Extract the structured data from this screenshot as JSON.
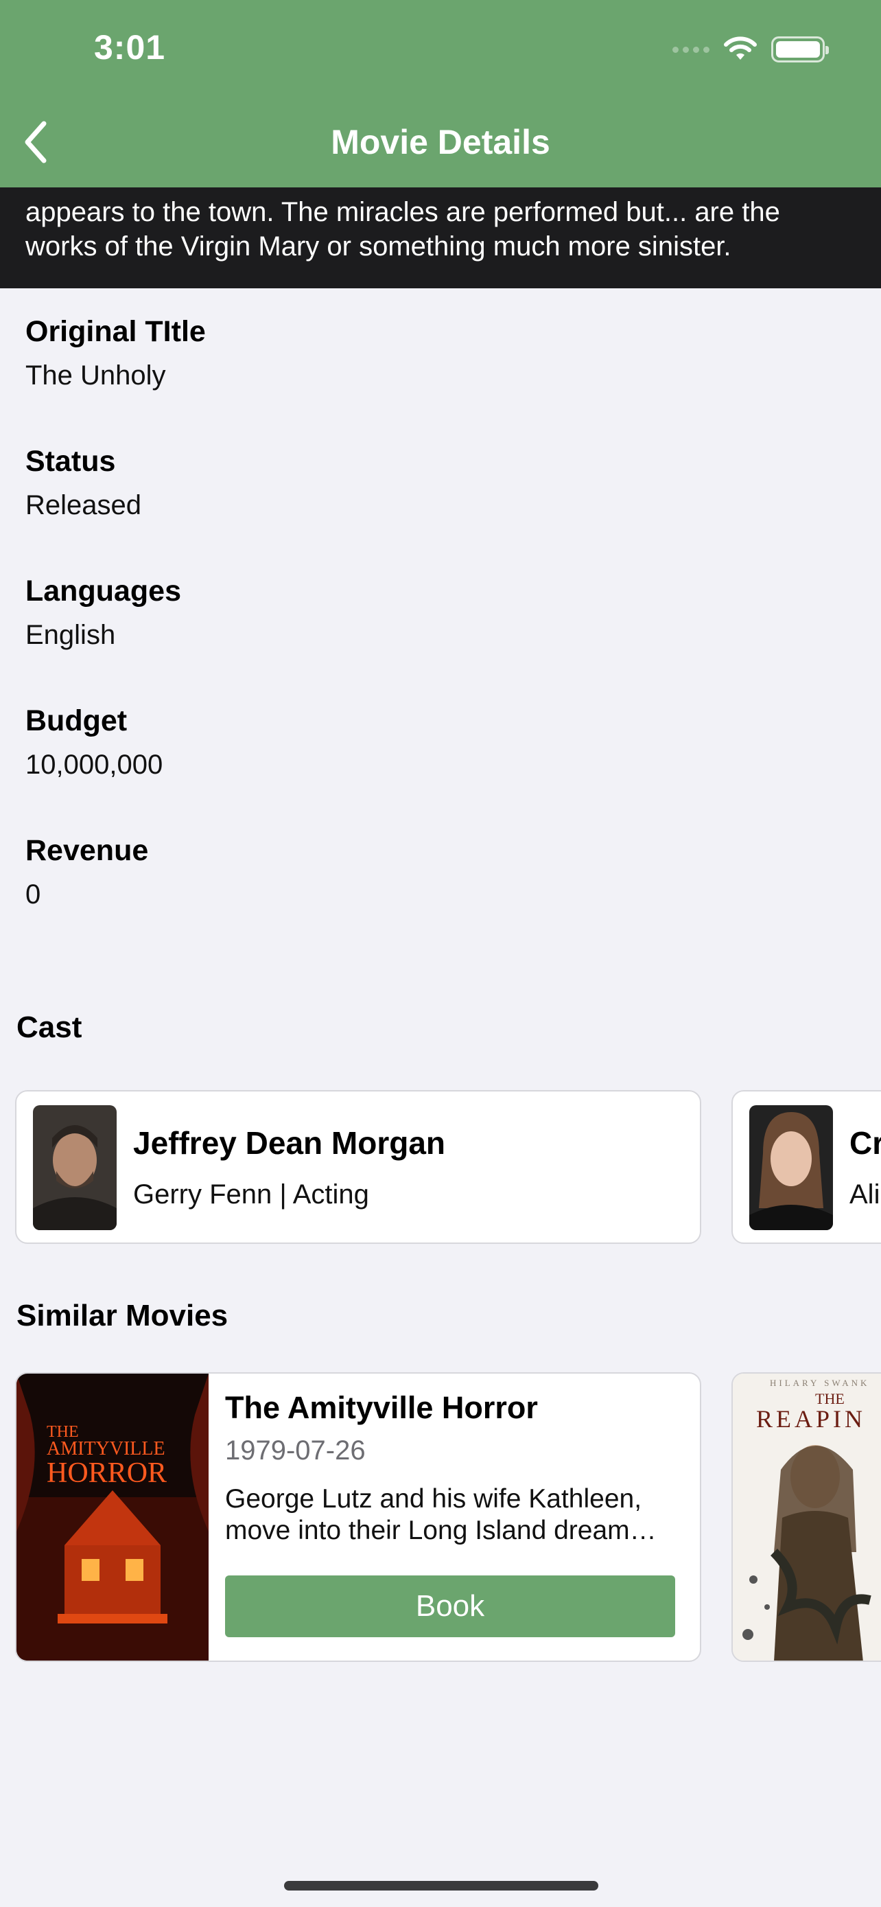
{
  "status_bar": {
    "time": "3:01"
  },
  "nav": {
    "title": "Movie Details",
    "back_icon": "chevron-left-icon"
  },
  "overview": {
    "text": "appears to the town. The miracles are performed but... are the works of the Virgin Mary or something much more sinister."
  },
  "details": [
    {
      "label": "Original TItle",
      "value": "The Unholy"
    },
    {
      "label": "Status",
      "value": "Released"
    },
    {
      "label": "Languages",
      "value": "English"
    },
    {
      "label": "Budget",
      "value": "10,000,000"
    },
    {
      "label": "Revenue",
      "value": "0"
    }
  ],
  "cast": {
    "title": "Cast",
    "items": [
      {
        "name": "Jeffrey Dean Morgan",
        "role": "Gerry Fenn | Acting"
      },
      {
        "name": "Cr",
        "role": "Ali"
      }
    ]
  },
  "similar": {
    "title": "Similar Movies",
    "items": [
      {
        "title": "The Amityville Horror",
        "date": "1979-07-26",
        "description": "George Lutz and his wife Kathleen, move into their Long Island dream…",
        "button": "Book",
        "poster_text": {
          "line1": "THE",
          "line2": "AMITYVILLE",
          "line3": "HORROR"
        }
      },
      {
        "poster_text": {
          "credit": "HILARY SWANK",
          "line1": "THE",
          "line2": "REAPIN"
        }
      }
    ]
  },
  "colors": {
    "accent": "#6BA56E",
    "background": "#F2F2F7",
    "overview_bg": "#1C1C1E"
  }
}
